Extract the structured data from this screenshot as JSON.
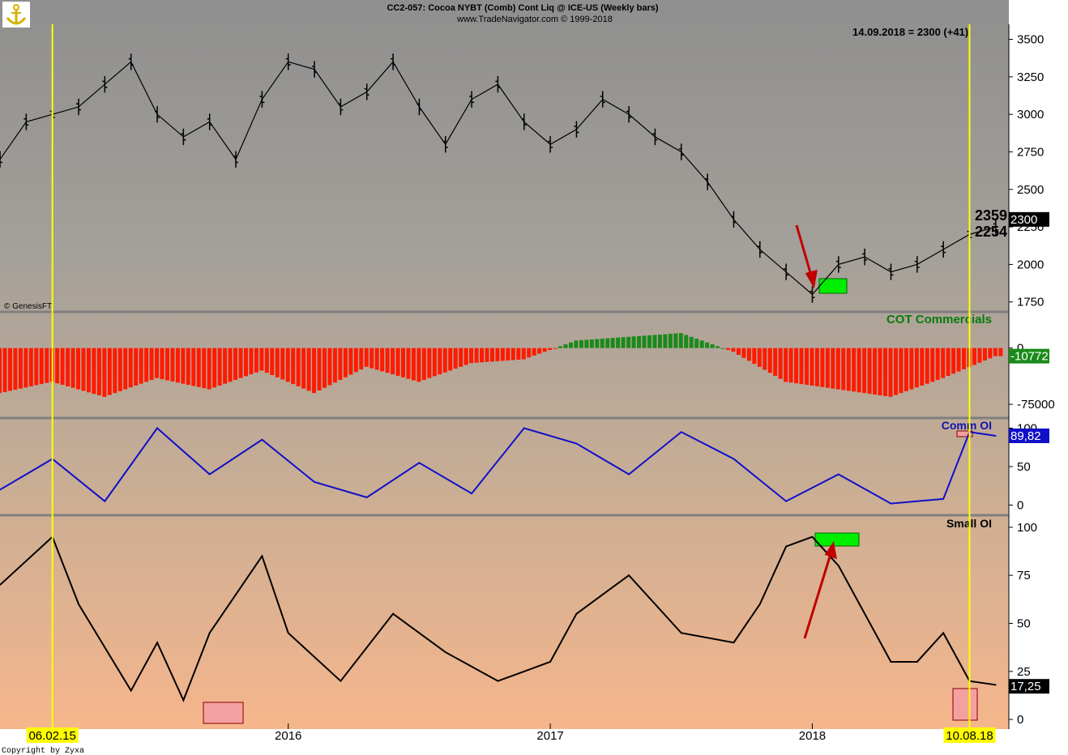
{
  "header": {
    "title": "CC2-057:  Cocoa NYBT (Comb) Cont Liq @ ICE-US  (Weekly bars)",
    "subtitle": "www.TradeNavigator.com © 1999-2018",
    "last_value_text": "14.09.2018 = 2300 (+41)",
    "watermark": "© GenesisFT",
    "copyright": "Copyright by Zyxa",
    "logo": "anchor-logo"
  },
  "colors": {
    "price": "#000000",
    "cot_positive": "#1a8a1a",
    "cot_negative": "#ff1a00",
    "comm_oi": "#1010c8",
    "small_oi": "#000000",
    "vline": "#ffff00",
    "highlight_red": "#f4a0a0",
    "highlight_green": "#00ee00",
    "arrow": "#b00000"
  },
  "chart_data": [
    {
      "type": "line",
      "panel": "price",
      "ylim": [
        1700,
        3600
      ],
      "yticks": [
        3500,
        3250,
        3000,
        2750,
        2500,
        2250,
        2000,
        1750
      ],
      "x_domain": [
        2014.9,
        2018.75
      ],
      "x_labels": [
        "2016",
        "2017",
        "2018"
      ],
      "x_label_positions": [
        2016.0,
        2017.0,
        2018.0
      ],
      "price_markers": [
        "2359",
        "2254"
      ],
      "last_badge": "2300",
      "x": [
        2014.9,
        2015.0,
        2015.1,
        2015.2,
        2015.3,
        2015.4,
        2015.5,
        2015.6,
        2015.7,
        2015.8,
        2015.9,
        2016.0,
        2016.1,
        2016.2,
        2016.3,
        2016.4,
        2016.5,
        2016.6,
        2016.7,
        2016.8,
        2016.9,
        2017.0,
        2017.1,
        2017.2,
        2017.3,
        2017.4,
        2017.5,
        2017.6,
        2017.7,
        2017.8,
        2017.9,
        2018.0,
        2018.1,
        2018.2,
        2018.3,
        2018.4,
        2018.5,
        2018.6,
        2018.7
      ],
      "y": [
        2700,
        2950,
        3000,
        3050,
        3200,
        3350,
        3000,
        2850,
        2950,
        2700,
        3100,
        3350,
        3300,
        3050,
        3150,
        3350,
        3050,
        2800,
        3100,
        3200,
        2950,
        2800,
        2900,
        3100,
        3000,
        2850,
        2750,
        2550,
        2300,
        2100,
        1950,
        1800,
        2000,
        2050,
        1950,
        2000,
        2100,
        2200,
        2250
      ]
    },
    {
      "type": "bar",
      "panel": "cot_commercials",
      "title": "COT Commercials",
      "ylim": [
        -90000,
        45000
      ],
      "yticks": [
        0,
        -75000
      ],
      "last_badge": "-10772",
      "x": [
        2014.9,
        2015.1,
        2015.3,
        2015.5,
        2015.7,
        2015.9,
        2016.1,
        2016.3,
        2016.5,
        2016.7,
        2016.9,
        2017.1,
        2017.3,
        2017.5,
        2017.7,
        2017.9,
        2018.1,
        2018.3,
        2018.5,
        2018.7
      ],
      "values": [
        -60000,
        -45000,
        -65000,
        -40000,
        -55000,
        -30000,
        -60000,
        -25000,
        -45000,
        -20000,
        -15000,
        10000,
        15000,
        20000,
        -5000,
        -45000,
        -55000,
        -65000,
        -40000,
        -10772
      ]
    },
    {
      "type": "line",
      "panel": "comm_oi",
      "title": "Comm OI",
      "ylim": [
        -10,
        110
      ],
      "yticks": [
        100,
        50,
        0
      ],
      "last_badge": "89,82",
      "x": [
        2014.9,
        2015.1,
        2015.3,
        2015.5,
        2015.7,
        2015.9,
        2016.1,
        2016.3,
        2016.5,
        2016.7,
        2016.9,
        2017.1,
        2017.3,
        2017.5,
        2017.7,
        2017.9,
        2018.1,
        2018.3,
        2018.5,
        2018.6,
        2018.7
      ],
      "y": [
        20,
        60,
        5,
        100,
        40,
        85,
        30,
        10,
        55,
        15,
        100,
        80,
        40,
        95,
        60,
        5,
        40,
        2,
        8,
        95,
        90
      ]
    },
    {
      "type": "line",
      "panel": "small_oi",
      "title": "Small OI",
      "ylim": [
        -5,
        105
      ],
      "yticks": [
        100,
        75,
        50,
        25,
        0
      ],
      "last_badge": "17,25",
      "x": [
        2014.9,
        2015.1,
        2015.2,
        2015.4,
        2015.5,
        2015.6,
        2015.7,
        2015.9,
        2016.0,
        2016.2,
        2016.4,
        2016.6,
        2016.8,
        2017.0,
        2017.1,
        2017.3,
        2017.5,
        2017.7,
        2017.8,
        2017.9,
        2018.0,
        2018.1,
        2018.2,
        2018.3,
        2018.4,
        2018.5,
        2018.6,
        2018.7
      ],
      "y": [
        70,
        95,
        60,
        15,
        40,
        10,
        45,
        85,
        45,
        20,
        55,
        35,
        20,
        30,
        55,
        75,
        45,
        40,
        60,
        90,
        95,
        80,
        55,
        30,
        30,
        45,
        20,
        18
      ]
    }
  ],
  "annotations": {
    "vline_dates": [
      "06.02.15",
      "10.08.18"
    ],
    "vline_x": [
      2015.1,
      2018.6
    ]
  }
}
